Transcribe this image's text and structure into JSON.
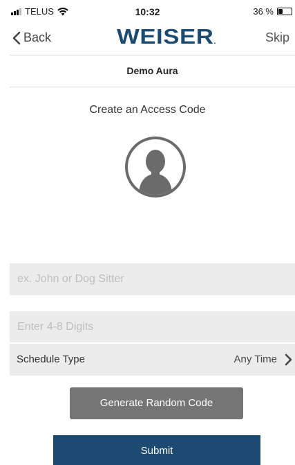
{
  "status_bar": {
    "carrier": "TELUS",
    "time": "10:32",
    "battery_text": "36 %",
    "battery_level": 0.36,
    "icons": [
      "signal-icon",
      "wifi-icon",
      "battery-icon"
    ]
  },
  "nav": {
    "back_label": "Back",
    "logo_text": "WEISER",
    "skip_label": "Skip",
    "back_icon": "chevron-left-icon"
  },
  "lock_name": "Demo Aura",
  "heading": "Create an Access Code",
  "avatar_icon": "user-avatar-icon",
  "form": {
    "name_placeholder": "ex. John or Dog Sitter",
    "name_value": "",
    "code_placeholder": "Enter 4-8 Digits",
    "code_value": "",
    "schedule_label": "Schedule Type",
    "schedule_value": "Any Time",
    "schedule_icon": "chevron-right-icon"
  },
  "buttons": {
    "generate_label": "Generate Random Code",
    "submit_label": "Submit"
  },
  "colors": {
    "brand": "#1d4a70",
    "field_bg": "#ececec",
    "secondary_button": "#757575"
  }
}
